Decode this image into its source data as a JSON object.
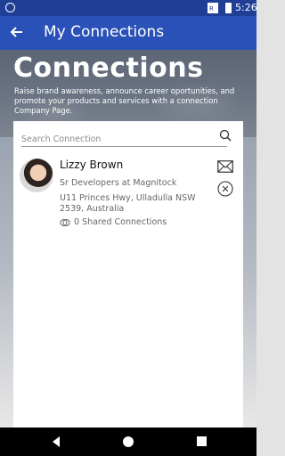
{
  "status_bar": {
    "time": "5:26"
  },
  "app_bar": {
    "title": "My Connections",
    "back_icon": "arrow-left-icon"
  },
  "hero": {
    "title": "Connections",
    "description": "Raise brand awareness, announce career oportunities, and promote your products and services with a connection Company Page."
  },
  "search": {
    "placeholder": "Search Connection",
    "icon": "search-icon"
  },
  "connections": [
    {
      "name": "Lizzy Brown",
      "role": "Sr Developers at Magnitock",
      "address": "U11 Princes Hwy, Ulladulla NSW 2539, Australia",
      "shared": "0 Shared Connections"
    }
  ],
  "colors": {
    "app_bar": "#2a51b8",
    "status_bar": "#1f3f97"
  }
}
